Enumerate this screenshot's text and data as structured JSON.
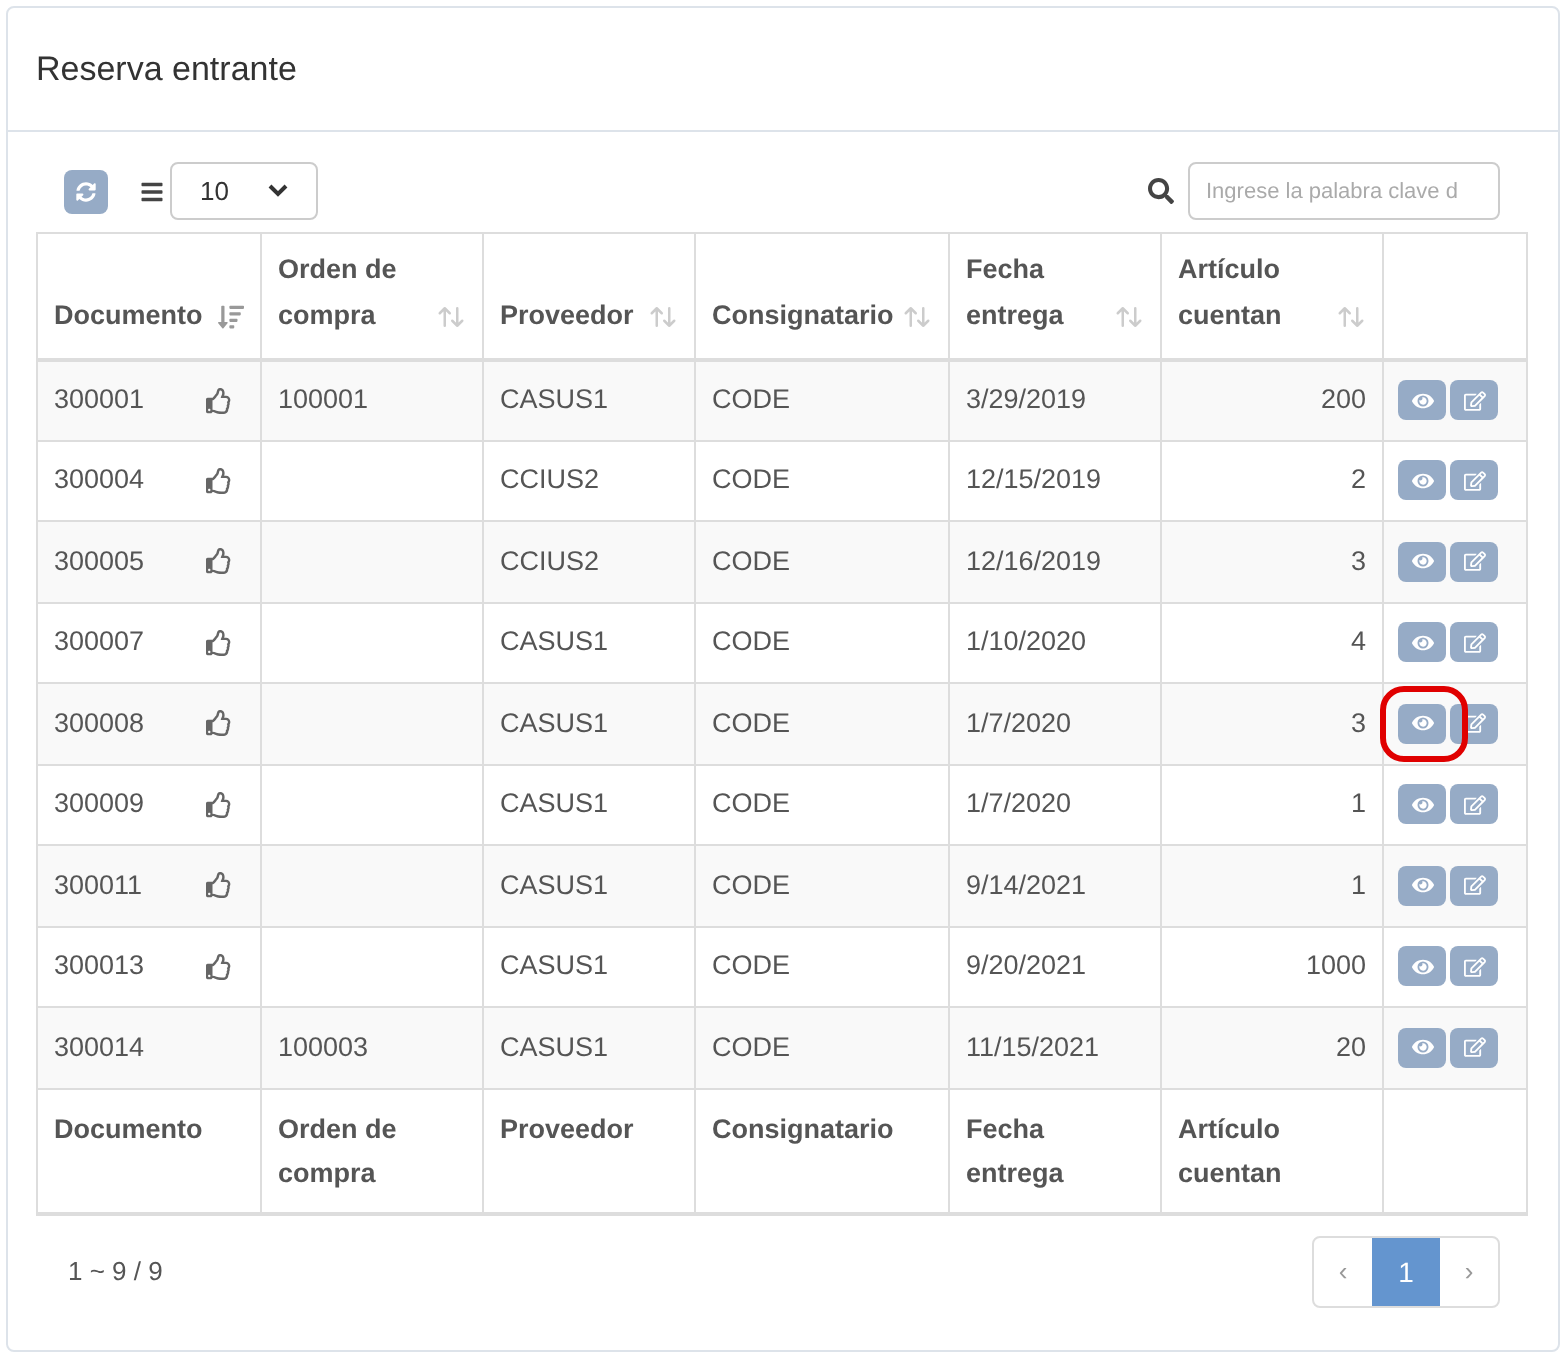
{
  "title": "Reserva entrante",
  "toolbar": {
    "page_size": "10",
    "search_placeholder": "Ingrese la palabra clave d"
  },
  "columns": [
    {
      "label": "Documento",
      "sorted": true
    },
    {
      "label": "Orden de compra",
      "sorted": false
    },
    {
      "label": "Proveedor",
      "sorted": false
    },
    {
      "label": "Consignatario",
      "sorted": false
    },
    {
      "label": "Fecha entrega",
      "sorted": false
    },
    {
      "label": "Artículo cuentan",
      "sorted": false
    }
  ],
  "rows": [
    {
      "cells": [
        "300001",
        "100001",
        "CASUS1",
        "CODE",
        "3/29/2019",
        "200"
      ],
      "liked": true,
      "highlighted": false
    },
    {
      "cells": [
        "300004",
        "",
        "CCIUS2",
        "CODE",
        "12/15/2019",
        "2"
      ],
      "liked": true,
      "highlighted": false
    },
    {
      "cells": [
        "300005",
        "",
        "CCIUS2",
        "CODE",
        "12/16/2019",
        "3"
      ],
      "liked": true,
      "highlighted": false
    },
    {
      "cells": [
        "300007",
        "",
        "CASUS1",
        "CODE",
        "1/10/2020",
        "4"
      ],
      "liked": true,
      "highlighted": false
    },
    {
      "cells": [
        "300008",
        "",
        "CASUS1",
        "CODE",
        "1/7/2020",
        "3"
      ],
      "liked": true,
      "highlighted": true
    },
    {
      "cells": [
        "300009",
        "",
        "CASUS1",
        "CODE",
        "1/7/2020",
        "1"
      ],
      "liked": true,
      "highlighted": false
    },
    {
      "cells": [
        "300011",
        "",
        "CASUS1",
        "CODE",
        "9/14/2021",
        "1"
      ],
      "liked": true,
      "highlighted": false
    },
    {
      "cells": [
        "300013",
        "",
        "CASUS1",
        "CODE",
        "9/20/2021",
        "1000"
      ],
      "liked": true,
      "highlighted": false
    },
    {
      "cells": [
        "300014",
        "100003",
        "CASUS1",
        "CODE",
        "11/15/2021",
        "20"
      ],
      "liked": false,
      "highlighted": false
    }
  ],
  "footer_columns": [
    "Documento",
    "Orden de compra",
    "Proveedor",
    "Consignatario",
    "Fecha entrega",
    "Artículo cuentan"
  ],
  "summary": "1 ~ 9 / 9",
  "pagination": {
    "prev": "‹",
    "pages": [
      {
        "label": "1",
        "selected": true
      }
    ],
    "next": "›"
  }
}
